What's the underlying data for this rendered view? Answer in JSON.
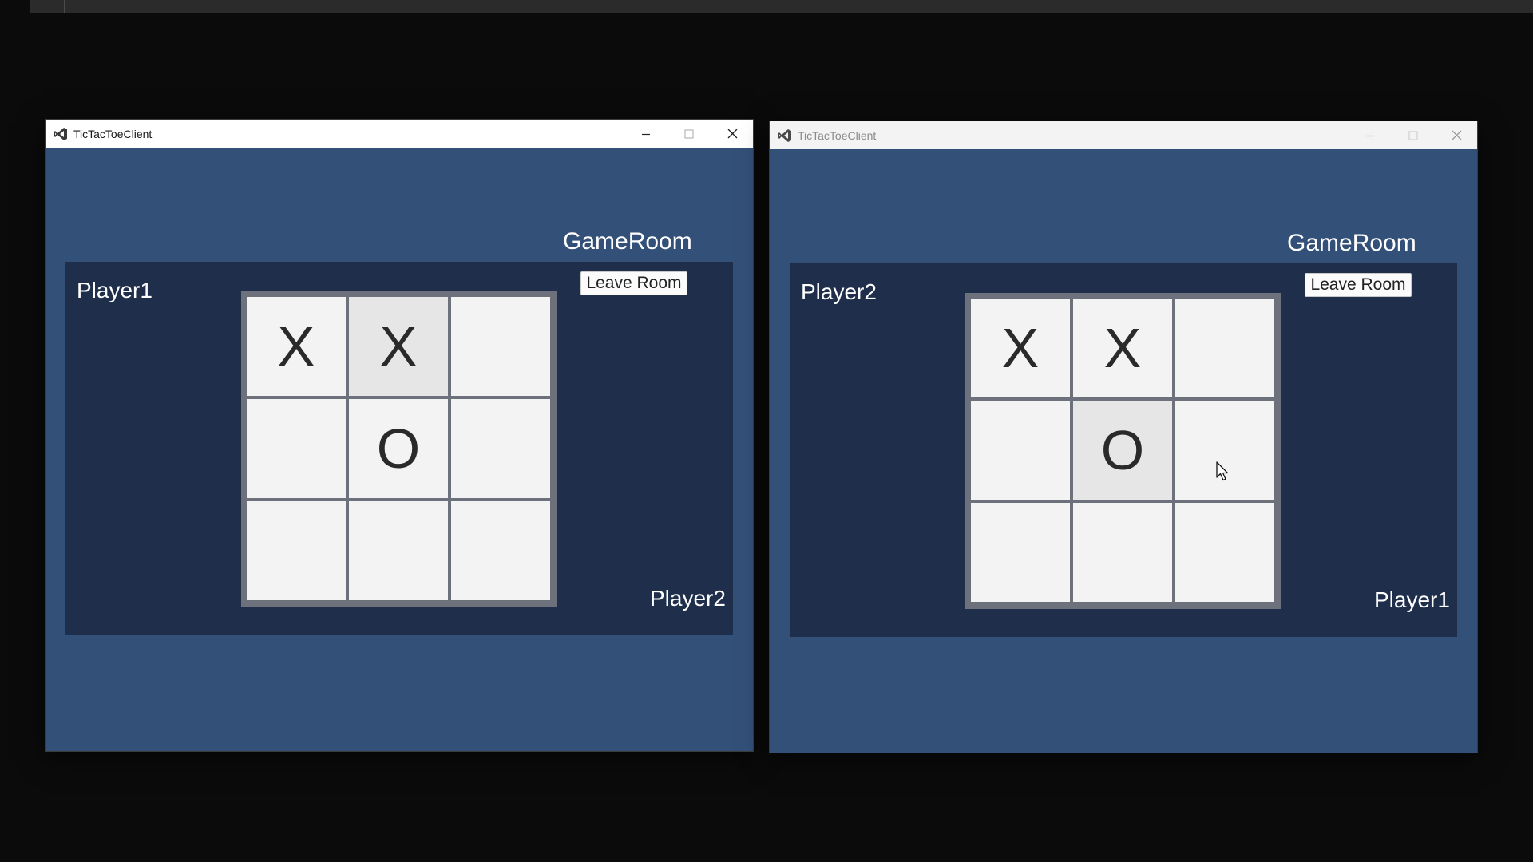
{
  "windows": [
    {
      "title": "TicTacToeClient",
      "room_title": "GameRoom",
      "leave_label": "Leave Room",
      "self_player": "Player1",
      "opponent_player": "Player2",
      "board": [
        "X",
        "X",
        "",
        "",
        "O",
        "",
        "",
        "",
        ""
      ],
      "highlighted_cell": 2
    },
    {
      "title": "TicTacToeClient",
      "room_title": "GameRoom",
      "leave_label": "Leave Room",
      "self_player": "Player2",
      "opponent_player": "Player1",
      "board": [
        "X",
        "X",
        "",
        "",
        "O",
        "",
        "",
        "",
        ""
      ],
      "highlighted_cell": 5
    }
  ],
  "icons": {
    "app": "visual-studio-icon",
    "minimize": "minimize-icon",
    "maximize": "maximize-icon",
    "close": "close-icon",
    "cursor": "mouse-cursor-icon"
  },
  "colors": {
    "window_bg": "#335078",
    "panel_bg": "#1f2e4b",
    "board_frame": "#6c717c",
    "cell_bg": "#f3f3f3",
    "cell_highlight": "#e6e6e6",
    "desktop_bg": "#0b0b0b"
  }
}
